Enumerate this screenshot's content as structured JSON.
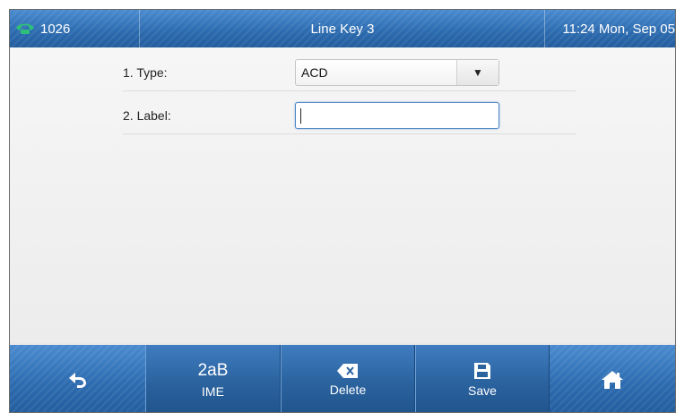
{
  "status_bar": {
    "extension": "1026",
    "title": "Line Key 3",
    "datetime": "11:24 Mon, Sep 05",
    "icons": {
      "extension": "phone-handset-icon"
    },
    "colors": {
      "bar": "#2f6fb5",
      "handset": "#2ec07a"
    }
  },
  "form": {
    "rows": [
      {
        "label": "1. Type:",
        "value": "ACD",
        "control": "dropdown"
      },
      {
        "label": "2. Label:",
        "value": "",
        "control": "text-input"
      }
    ]
  },
  "softkeys": [
    {
      "id": "back",
      "label": "",
      "icon": "back-arrow-icon"
    },
    {
      "id": "ime",
      "top": "2aB",
      "label": "IME"
    },
    {
      "id": "delete",
      "label": "Delete",
      "icon": "backspace-icon"
    },
    {
      "id": "save",
      "label": "Save",
      "icon": "save-disk-icon"
    },
    {
      "id": "home",
      "label": "",
      "icon": "home-icon"
    }
  ]
}
